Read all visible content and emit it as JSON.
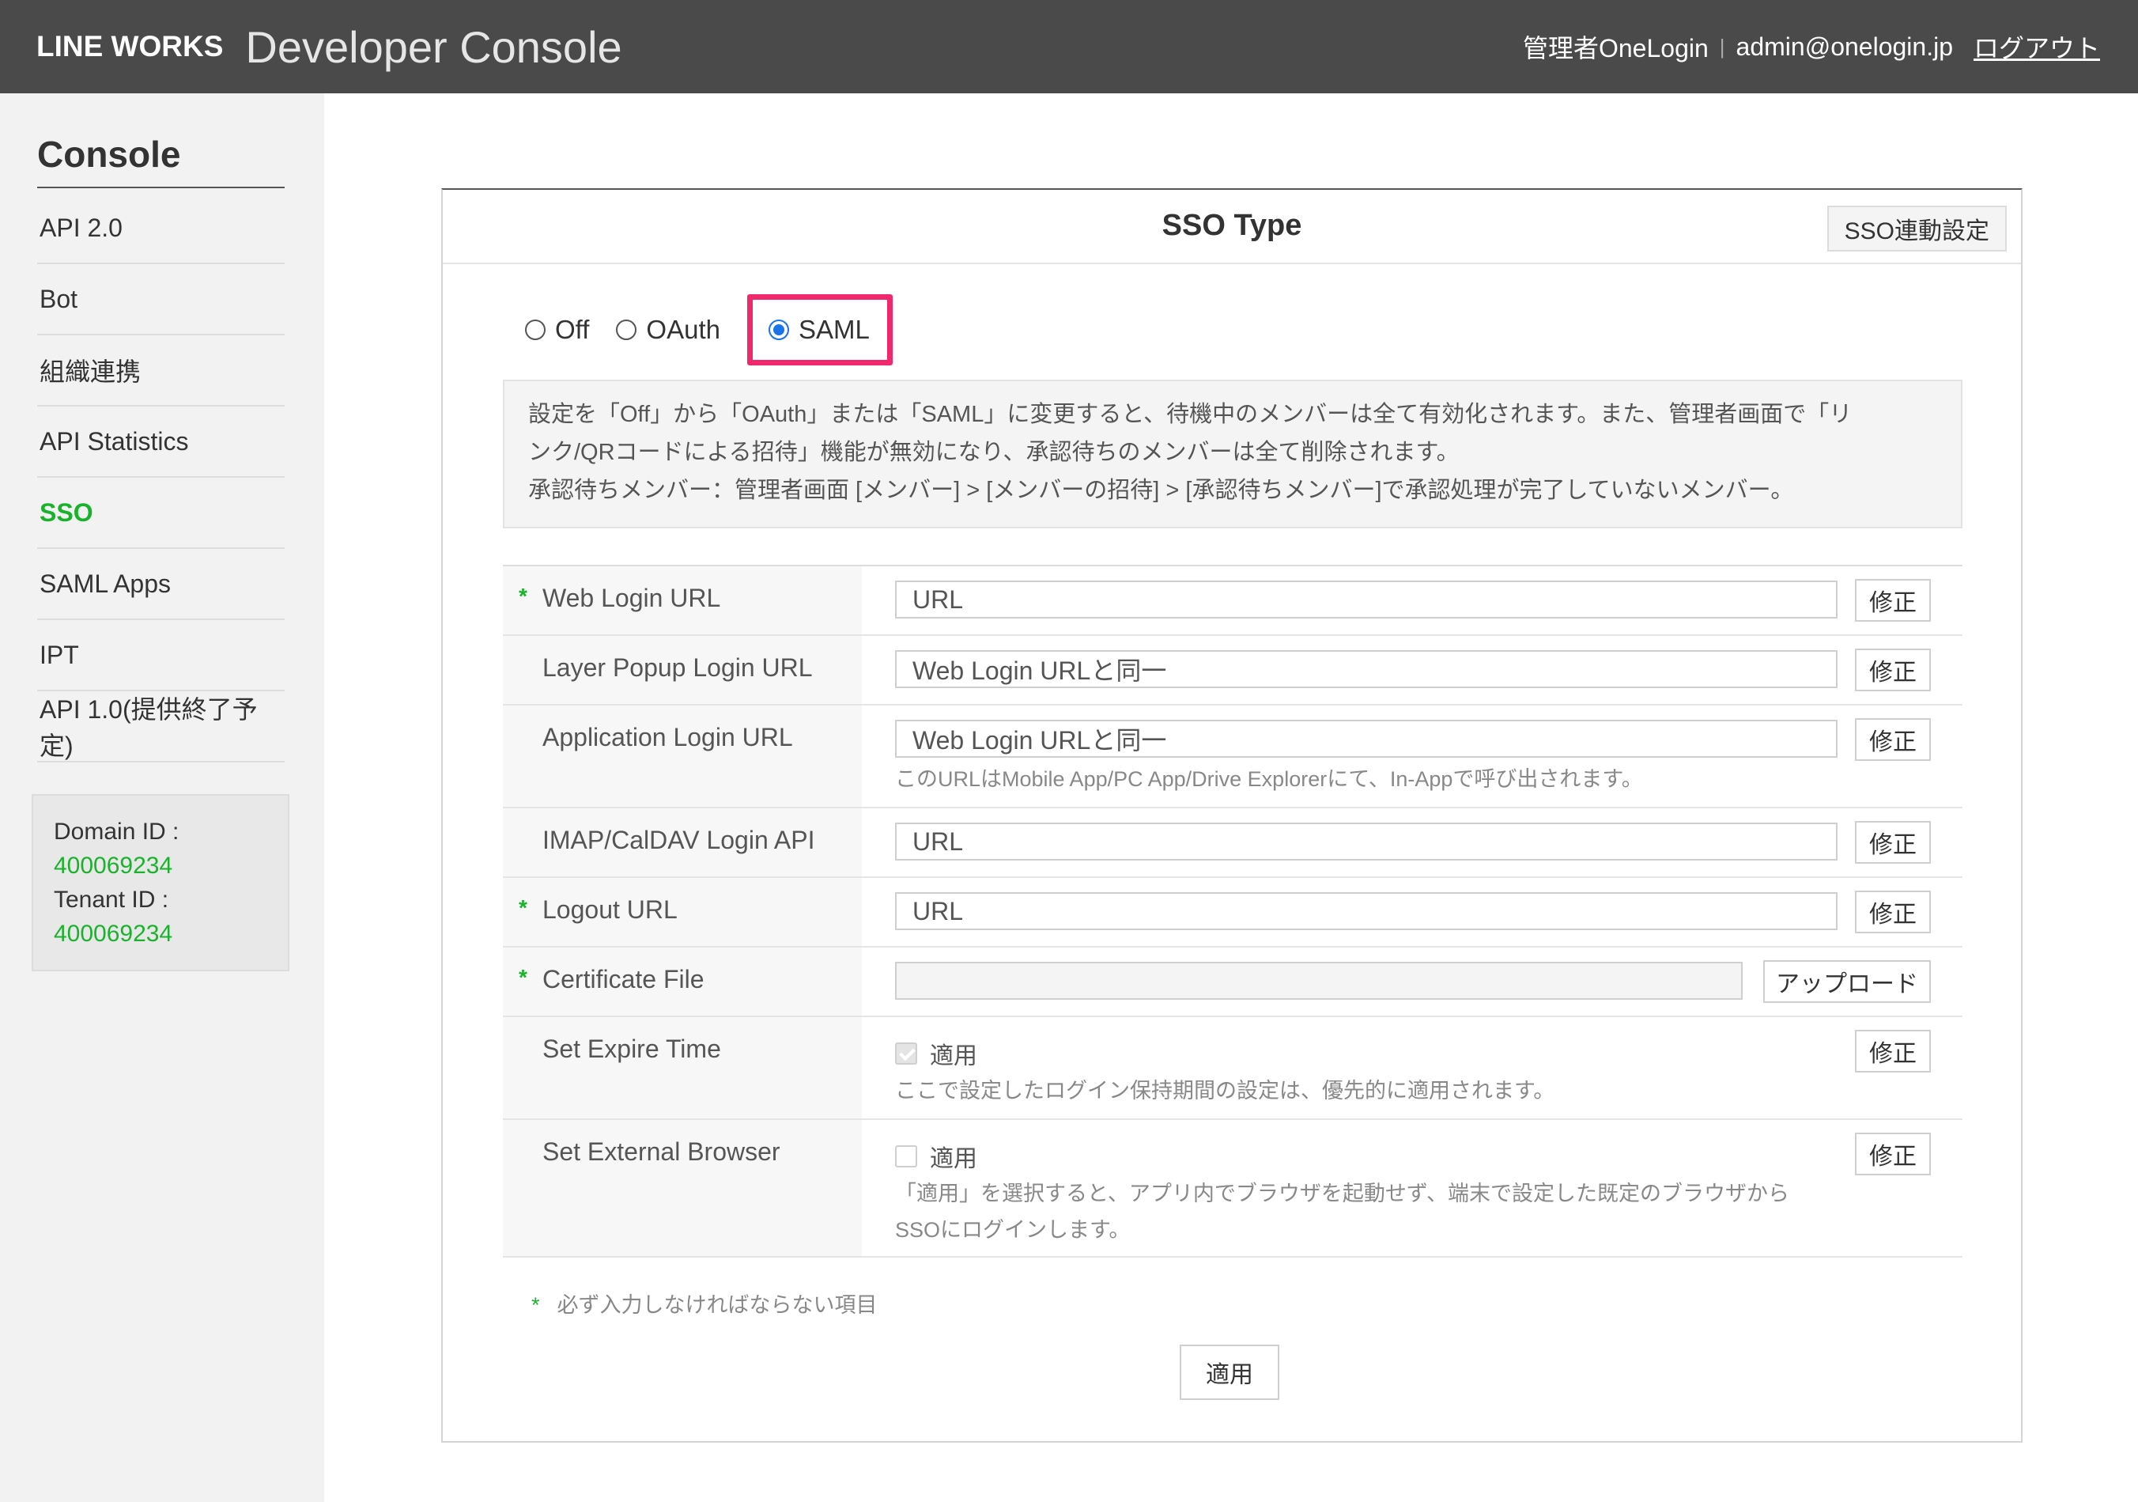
{
  "header": {
    "logo": "LINE WORKS",
    "title": "Developer Console",
    "user": "管理者OneLogin",
    "email": "admin@onelogin.jp",
    "logout": "ログアウト"
  },
  "sidebar": {
    "title": "Console",
    "items": [
      {
        "label": "API 2.0"
      },
      {
        "label": "Bot"
      },
      {
        "label": "組織連携"
      },
      {
        "label": "API Statistics"
      },
      {
        "label": "SSO"
      },
      {
        "label": "SAML Apps"
      },
      {
        "label": "IPT"
      },
      {
        "label": "API 1.0(提供終了予定)"
      }
    ],
    "active": "SSO",
    "domain_label": "Domain ID :",
    "domain_id": "400069234",
    "tenant_label": "Tenant ID :",
    "tenant_id": "400069234"
  },
  "panel": {
    "title": "SSO Type",
    "link_button": "SSO連動設定",
    "radio_options": [
      {
        "label": "Off",
        "checked": false
      },
      {
        "label": "OAuth",
        "checked": false
      },
      {
        "label": "SAML",
        "checked": true
      }
    ],
    "notice_lines": [
      "設定を「Off」から「OAuth」または「SAML」に変更すると、待機中のメンバーは全て有効化されます。また、管理者画面で「リ",
      "ンク/QRコードによる招待」機能が無効になり、承認待ちのメンバーは全て削除されます。",
      "承認待ちメンバー：管理者画面 [メンバー] > [メンバーの招待] > [承認待ちメンバー]で承認処理が完了していないメンバー。"
    ],
    "fields": {
      "web_login": {
        "label": "Web Login URL",
        "required": "*",
        "value": "URL",
        "button": "修正"
      },
      "layer_popup": {
        "label": "Layer Popup Login URL",
        "value": "Web Login URLと同一",
        "button": "修正"
      },
      "app_login": {
        "label": "Application Login URL",
        "value": "Web Login URLと同一",
        "button": "修正",
        "help": "このURLはMobile App/PC App/Drive Explorerにて、In-Appで呼び出されます。"
      },
      "imap": {
        "label": "IMAP/CalDAV Login API",
        "value": "URL",
        "button": "修正"
      },
      "logout": {
        "label": "Logout URL",
        "required": "*",
        "value": "URL",
        "button": "修正"
      },
      "certificate": {
        "label": "Certificate File",
        "required": "*",
        "value": "",
        "button": "アップロード"
      },
      "expire": {
        "label": "Set Expire Time",
        "checkbox_label": "適用",
        "checked": true,
        "button": "修正",
        "help": "ここで設定したログイン保持期間の設定は、優先的に適用されます。"
      },
      "external_browser": {
        "label": "Set External Browser",
        "checkbox_label": "適用",
        "checked": false,
        "button": "修正",
        "help_lines": [
          "「適用」を選択すると、アプリ内でブラウザを起動せず、端末で設定した既定のブラウザから",
          "SSOにログインします。"
        ]
      }
    },
    "required_note_star": "*",
    "required_note": "必ず入力しなければならない項目",
    "apply_button": "適用"
  },
  "colors": {
    "header_bg": "#4a4a4a",
    "accent_green": "#19b32b",
    "highlight_pink": "#f0286c",
    "radio_blue": "#1a73e8"
  }
}
